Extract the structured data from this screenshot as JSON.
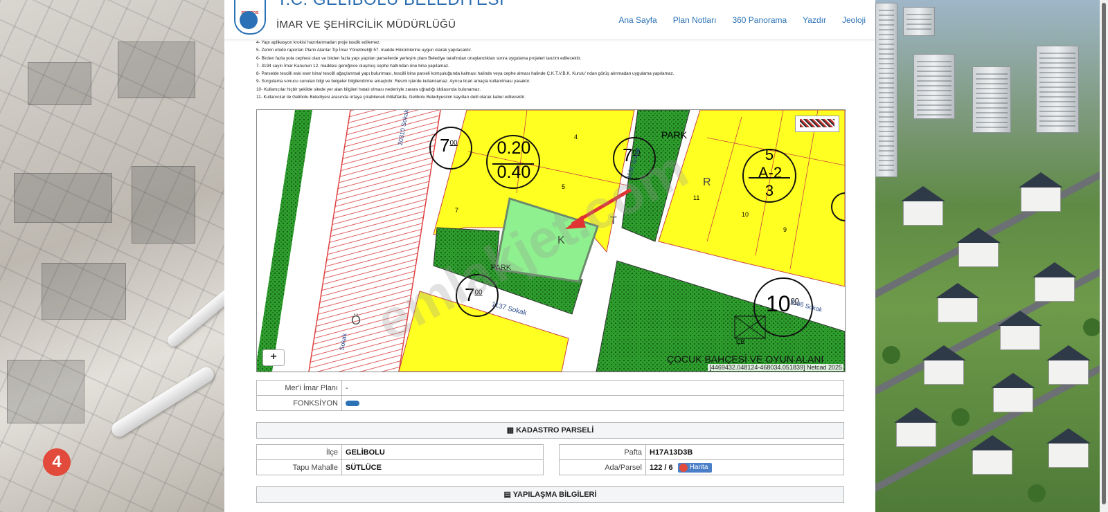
{
  "header": {
    "title": "T.C. GELİBOLU BELEDİYESİ",
    "subtitle": "İMAR VE ŞEHİRCİLİK MÜDÜRLÜĞÜ",
    "nav": [
      "Ana Sayfa",
      "Plan Notları",
      "360 Panorama",
      "Yazdır",
      "Jeoloji"
    ]
  },
  "notes": [
    "4- Yapı aplikasyon krokisi hazırlanmadan proje tasdik edilemez.",
    "5- Zemin etüdü raporları Planlı Alanlar Tip İmar Yönetmeliği 57. madde Hükümlerine uygun olarak yapılacaktır.",
    "6- Birden fazla yola cephesi olan ve birden fazla yapı yapılan parsellerde yerleşim planı Belediye tarafından onaylandıktan sonra uygulama projeleri tanzim edilecektir.",
    "7- 3194 sayılı İmar Kanunun 12. maddesi gereğince oluşmuş cephe hattından öne bina yapılamaz.",
    "8- Parselde tescilli eski eser bina/ tescilli ağaç/anıtsal yapı bulunması, tescilli bina parseli komşuluğunda kalması halinde veya cephe alması halinde Ç.K.T.V.B.K. Kurulu' ndan görüş alınmadan uygulama yapılamaz.",
    "9- Sorgulama sonucu sunulan bilgi ve belgeler bilgilendirme amaçlıdır. Resmi işlerde kullanılamaz. Ayrıca ticari amaçla kullanılması yasaktır.",
    "10- Kullanıcılar hiçbir şekilde sitede yer alan bilgileri hatalı olması nedeniyle zarara uğradığı iddiasında bulunamaz.",
    "11- Kullanıcılar ile Gelibolu Belediyesi arasında ortaya çıkabilecek ihtilaflarda, Gelibolu Belediyesinin kayıtları delil olarak kabul edilecektir."
  ],
  "map": {
    "labels": {
      "ratio_top": "0.20",
      "ratio_bottom": "0.40",
      "park1": "PARK",
      "park2": "PARK",
      "tag_a2_top": "5",
      "tag_a2_mid": "A-2",
      "tag_a2_bot": "3",
      "height7a": "7",
      "height7b": "7",
      "height7c": "7",
      "height10": "10",
      "sup00": "00",
      "street1": "1137 Sokak",
      "street2": "1136 Sokak",
      "street3": "20310 Sokak",
      "street4": "1136 Sokak",
      "street5": "Sokak",
      "parcel4": "4",
      "parcel5": "5",
      "parcel7": "7",
      "parcel9": "9",
      "parcel10": "10",
      "parcel11": "11",
      "bottom_text": "ÇOCUK BAHÇESİ VE OYUN ALANI",
      "cb": "ÇB",
      "o_letter": "Ö",
      "k_letter": "K",
      "t_letter": "T",
      "r_letter": "R",
      "sokak_vert": "Sokak"
    },
    "watermark": "emlakjet.com",
    "zoom_in": "+",
    "coords": "[4469432.048124-468034.051839] Netcad 2025"
  },
  "plan_table": [
    {
      "label": "Mer'i İmar Planı",
      "value": "-"
    },
    {
      "label": "FONKSİYON",
      "value": ""
    }
  ],
  "kadastro": {
    "title": "KADASTRO PARSELİ",
    "ilce_label": "İlçe",
    "ilce_value": "GELİBOLU",
    "mahalle_label": "Tapu Mahalle",
    "mahalle_value": "SÜTLÜCE",
    "pafta_label": "Pafta",
    "pafta_value": "H17A13D3B",
    "ada_label": "Ada/Parsel",
    "ada_value": "122 / 6",
    "harita_label": "Harita"
  },
  "yapilasma": {
    "title": "YAPILAŞMA BİLGİLERİ"
  },
  "colors": {
    "accent": "#2a72b5",
    "yellow_zone": "#ffff22",
    "green_zone": "#2e9d2e",
    "selected_parcel": "#8ef08e"
  }
}
